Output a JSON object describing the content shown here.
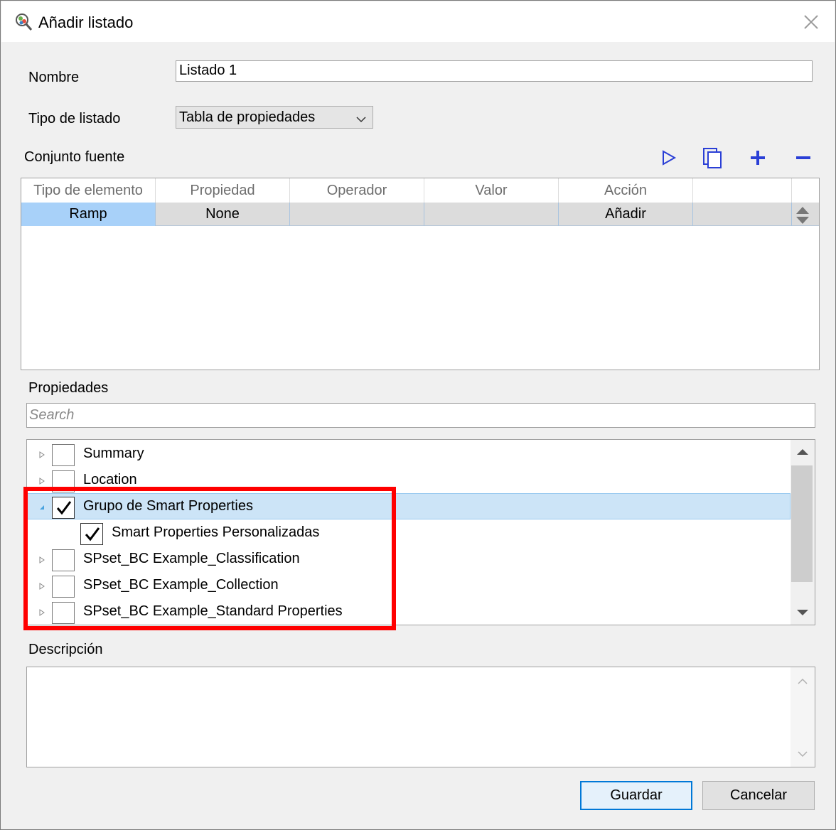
{
  "window": {
    "title": "Añadir listado",
    "app_icon": "app-logo-icon",
    "close_icon": "close-icon"
  },
  "form": {
    "name_label": "Nombre",
    "name_value": "Listado 1",
    "type_label": "Tipo de listado",
    "type_value": "Tabla de propiedades",
    "source_label": "Conjunto fuente"
  },
  "toolbar": {
    "icons": [
      "play-icon",
      "copy-icon",
      "add-icon",
      "remove-icon"
    ]
  },
  "grid": {
    "columns": [
      "Tipo de elemento",
      "Propiedad",
      "Operador",
      "Valor",
      "Acción",
      ""
    ],
    "rows": [
      {
        "tipo": "Ramp",
        "propiedad": "None",
        "operador": "",
        "valor": "",
        "accion": "Añadir"
      }
    ]
  },
  "properties": {
    "label": "Propiedades",
    "search_placeholder": "Search",
    "items": [
      {
        "label": "Summary",
        "checked": false,
        "expanded": false
      },
      {
        "label": "Location",
        "checked": false,
        "expanded": false
      },
      {
        "label": "Grupo de Smart Properties",
        "checked": true,
        "expanded": true
      },
      {
        "label": "Smart Properties Personalizadas",
        "checked": true,
        "child": true
      },
      {
        "label": "SPset_BC Example_Classification",
        "checked": false,
        "expanded": false
      },
      {
        "label": "SPset_BC Example_Collection",
        "checked": false,
        "expanded": false
      },
      {
        "label": "SPset_BC Example_Standard Properties",
        "checked": false,
        "expanded": false
      }
    ]
  },
  "description": {
    "label": "Descripción",
    "value": ""
  },
  "buttons": {
    "save": "Guardar",
    "cancel": "Cancelar"
  },
  "colors": {
    "accent": "#0078d7",
    "highlight": "#ff0000",
    "toolbar_icon": "#2a3fd6",
    "selection": "#cce4f7"
  }
}
